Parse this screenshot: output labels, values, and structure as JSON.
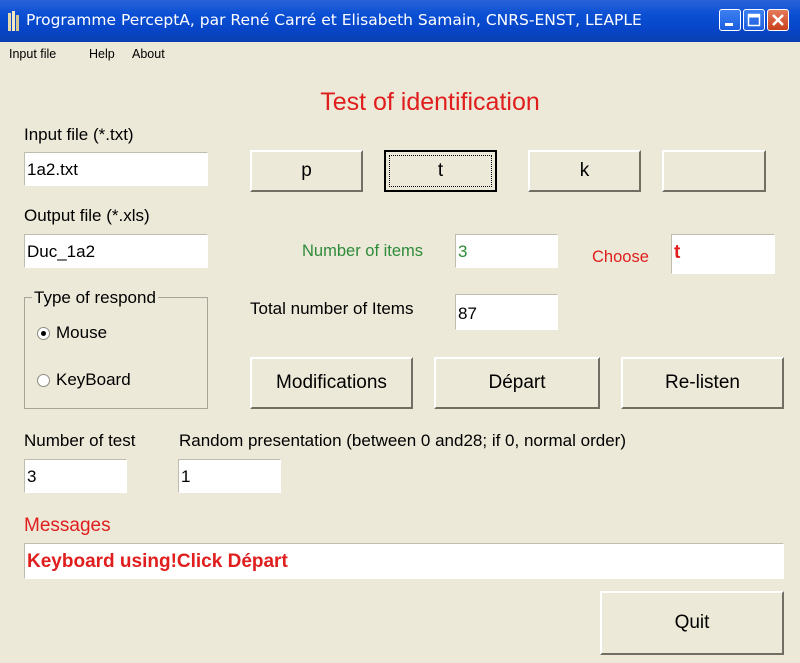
{
  "window": {
    "title": "Programme PerceptA, par René Carré et Elisabeth Samain, CNRS-ENST, LEAPLE"
  },
  "menu": {
    "input_file": "Input file",
    "help": "Help",
    "about": "About"
  },
  "header": {
    "title": "Test of identification"
  },
  "input_file": {
    "label": "Input file (*.txt)",
    "value": "1a2.txt"
  },
  "output_file": {
    "label": "Output file (*.xls)",
    "value": "Duc_1a2"
  },
  "choice_buttons": {
    "b1": "p",
    "b2": "t",
    "b3": "k",
    "b4": ""
  },
  "items": {
    "number_label": "Number of items",
    "number_value": "3",
    "choose_label": "Choose",
    "choose_value": "t",
    "total_label": "Total number of Items",
    "total_value": "87"
  },
  "respond": {
    "title": "Type of respond",
    "mouse": "Mouse",
    "keyboard": "KeyBoard",
    "selected": "Mouse"
  },
  "actions": {
    "modifications": "Modifications",
    "depart": "Départ",
    "relisten": "Re-listen",
    "quit": "Quit"
  },
  "test": {
    "number_label": "Number of test",
    "number_value": "3",
    "random_label": "Random presentation (between 0 and28; if 0, normal order)",
    "random_value": "1"
  },
  "messages": {
    "label": "Messages",
    "text": "Keyboard using!Click Départ"
  },
  "colors": {
    "accent_red": "#e01e1e",
    "green_label": "#2e8b3a",
    "titlebar_blue": "#0a4fd4",
    "window_bg": "#ece9d8"
  }
}
